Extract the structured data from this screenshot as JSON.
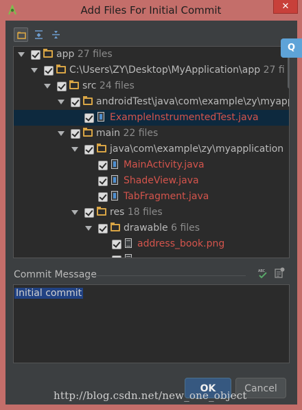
{
  "window": {
    "title": "Add Files For Initial Commit",
    "close_glyph": "✕"
  },
  "side_widget": {
    "label": "Q"
  },
  "tree": [
    {
      "name": "app",
      "count": "27 files",
      "type": "folder"
    },
    {
      "name": "C:\\Users\\ZY\\Desktop\\MyApplication\\app",
      "count": "27 fi",
      "type": "folder"
    },
    {
      "name": "src",
      "count": "24 files",
      "type": "folder"
    },
    {
      "name": "androidTest\\java\\com\\example\\zy\\myapp",
      "count": "",
      "type": "folder"
    },
    {
      "name": "ExampleInstrumentedTest.java",
      "count": "",
      "type": "java"
    },
    {
      "name": "main",
      "count": "22 files",
      "type": "folder"
    },
    {
      "name": "java\\com\\example\\zy\\myapplication",
      "count": "",
      "type": "folder"
    },
    {
      "name": "MainActivity.java",
      "count": "",
      "type": "java"
    },
    {
      "name": "ShadeView.java",
      "count": "",
      "type": "java"
    },
    {
      "name": "TabFragment.java",
      "count": "",
      "type": "java"
    },
    {
      "name": "res",
      "count": "18 files",
      "type": "folder"
    },
    {
      "name": "drawable",
      "count": "6 files",
      "type": "folder"
    },
    {
      "name": "address_book.png",
      "count": "",
      "type": "png"
    }
  ],
  "commit": {
    "label": "Commit Message",
    "message": "Initial commit"
  },
  "buttons": {
    "ok": "OK",
    "cancel": "Cancel"
  },
  "watermark": "http://blog.csdn.net/new_one_object"
}
